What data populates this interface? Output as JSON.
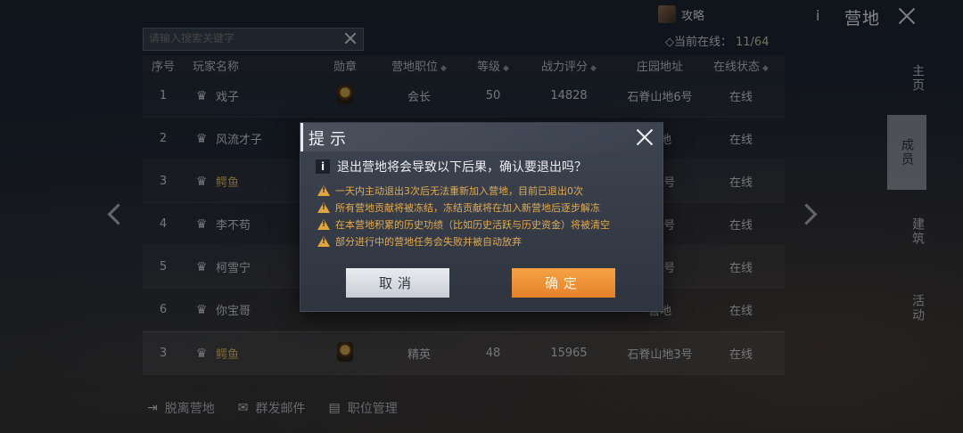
{
  "topbar": {
    "username": "攻略",
    "info_icon": "i",
    "title": "营地"
  },
  "search": {
    "placeholder": "请输入搜索关键字"
  },
  "online": {
    "label": "◇当前在线：",
    "count": "11/64"
  },
  "table": {
    "headers": [
      "序号",
      "玩家名称",
      "勋章",
      "营地职位",
      "等级",
      "战力评分",
      "庄园地址",
      "在线状态"
    ],
    "rows": [
      {
        "idx": "1",
        "name": "戏子",
        "gold": false,
        "role": "会长",
        "level": "50",
        "power": "14828",
        "address": "石脊山地6号",
        "status": "在线"
      },
      {
        "idx": "2",
        "name": "风流才子",
        "gold": false,
        "role": "",
        "level": "",
        "power": "",
        "address": "营地",
        "status": "在线"
      },
      {
        "idx": "3",
        "name": "鳄鱼",
        "gold": true,
        "role": "",
        "level": "",
        "power": "",
        "address": "地3号",
        "status": "在线"
      },
      {
        "idx": "4",
        "name": "李不苟",
        "gold": false,
        "role": "",
        "level": "",
        "power": "",
        "address": "地6号",
        "status": "在线"
      },
      {
        "idx": "5",
        "name": "柯雪宁",
        "gold": false,
        "role": "",
        "level": "",
        "power": "",
        "address": "地5号",
        "status": "在线"
      },
      {
        "idx": "6",
        "name": "你宝哥",
        "gold": false,
        "role": "",
        "level": "",
        "power": "",
        "address": "营地",
        "status": "在线"
      },
      {
        "idx": "3",
        "name": "鳄鱼",
        "gold": true,
        "role": "精英",
        "level": "48",
        "power": "15965",
        "address": "石脊山地3号",
        "status": "在线"
      }
    ]
  },
  "side_tabs": [
    "主页",
    "成员",
    "建筑",
    "活动"
  ],
  "bottom_actions": [
    "脱离营地",
    "群发邮件",
    "职位管理"
  ],
  "dialog": {
    "title": "提示",
    "question": "退出营地将会导致以下后果，确认要退出吗？",
    "warnings": [
      "一天内主动退出3次后无法重新加入营地，目前已退出0次",
      "所有营地贡献将被冻结，冻结贡献将在加入新营地后逐步解冻",
      "在本营地积累的历史功绩（比如历史活跃与历史资金）将被清空",
      "部分进行中的营地任务会失败并被自动放弃"
    ],
    "cancel_label": "取消",
    "confirm_label": "确定"
  },
  "colors": {
    "accent": "#e5822a",
    "warning": "#e3ab4c",
    "gold_name": "#d9b45a"
  }
}
